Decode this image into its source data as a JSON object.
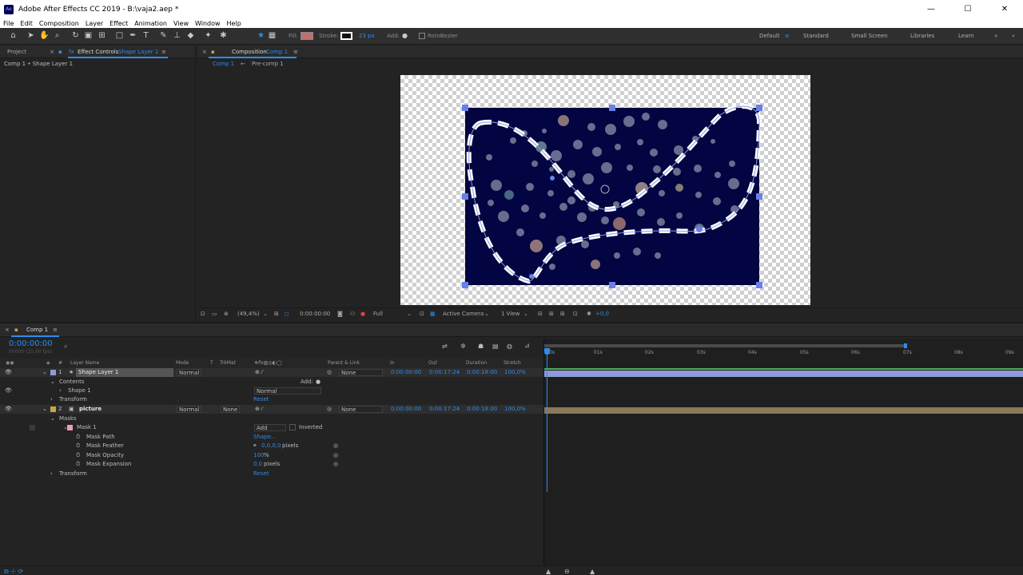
{
  "window": {
    "title": "Adobe After Effects CC 2019 - B:\\vaja2.aep *",
    "app_icon": "Ae"
  },
  "menu": [
    "File",
    "Edit",
    "Composition",
    "Layer",
    "Effect",
    "Animation",
    "View",
    "Window",
    "Help"
  ],
  "toolbar": {
    "fill_label": "Fill:",
    "stroke_label": "Stroke:",
    "stroke_width": "23 px",
    "add_label": "Add:",
    "rotobezier_label": "RotoBezier",
    "workspaces": [
      "Default",
      "Standard",
      "Small Screen",
      "Libraries",
      "Learn"
    ],
    "fill_color": "#c07070"
  },
  "left_panel": {
    "tab_project": "Project",
    "tab_effect_controls_prefix": "Effect Controls",
    "tab_effect_controls_layer": "Shape Layer 1",
    "breadcrumb": "Comp 1 • Shape Layer 1"
  },
  "comp_panel": {
    "tab_prefix": "Composition",
    "tab_comp": "Comp 1",
    "subtabs": [
      "Comp 1",
      "Pre-comp 1"
    ],
    "zoom": "(49,4%)",
    "timecode": "0:00:00:00",
    "resolution": "Full",
    "camera": "Active Camera",
    "view": "1 View",
    "exposure": "+0,0"
  },
  "timeline": {
    "tab": "Comp 1",
    "timecode": "0:00:00:00",
    "timecode_sub": "00000 (25.00 fps)",
    "columns": {
      "layer_name": "Layer Name",
      "mode": "Mode",
      "t": "T",
      "trkmat": "TrkMat",
      "parent": "Parent & Link",
      "in": "In",
      "out": "Out",
      "duration": "Duration",
      "stretch": "Stretch"
    },
    "ruler": [
      "0s",
      "01s",
      "02s",
      "03s",
      "04s",
      "05s",
      "06s",
      "07s",
      "08s",
      "09s"
    ],
    "layer1": {
      "num": "1",
      "name": "Shape Layer 1",
      "mode": "Normal",
      "parent": "None",
      "in": "0:00:00:00",
      "out": "0:00:17:24",
      "duration": "0:00:18:00",
      "stretch": "100,0%",
      "contents": "Contents",
      "add": "Add:",
      "shape1": "Shape 1",
      "shape1_mode": "Normal",
      "transform": "Transform",
      "transform_value": "Reset"
    },
    "layer2": {
      "num": "2",
      "name": "picture",
      "mode": "Normal",
      "trkmat": "None",
      "parent": "None",
      "in": "0:00:00:00",
      "out": "0:00:17:24",
      "duration": "0:00:18:00",
      "stretch": "100,0%",
      "masks": "Masks",
      "mask1": "Mask 1",
      "mask_mode": "Add",
      "inverted": "Inverted",
      "mask_path": "Mask Path",
      "mask_path_value": "Shape...",
      "mask_feather": "Mask Feather",
      "mask_feather_value": "0,0,0,0",
      "mask_feather_unit": "pixels",
      "mask_opacity": "Mask Opacity",
      "mask_opacity_value": "100",
      "mask_opacity_unit": "%",
      "mask_expansion": "Mask Expansion",
      "mask_expansion_value": "0,0",
      "mask_expansion_unit": "pixels",
      "transform": "Transform",
      "transform_value": "Reset"
    },
    "colors": {
      "layer1_bar": "#8e9bd8",
      "layer2_bar": "#8a7a5a"
    }
  }
}
